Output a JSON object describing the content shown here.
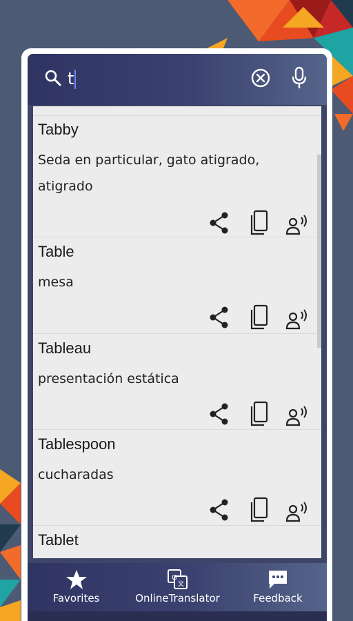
{
  "search": {
    "value": "t",
    "icon": "search-icon",
    "clear_icon": "clear-icon",
    "mic_icon": "mic-icon"
  },
  "results": [
    {
      "word": "Tabby",
      "translation": "Seda en particular, gato atigrado, atigrado"
    },
    {
      "word": "Table",
      "translation": "mesa"
    },
    {
      "word": "Tableau",
      "translation": "presentación estática"
    },
    {
      "word": "Tablespoon",
      "translation": "cucharadas"
    },
    {
      "word": "Tablet",
      "translation": ""
    }
  ],
  "row_actions": [
    "share-icon",
    "copy-icon",
    "speak-icon"
  ],
  "nav": {
    "favorites": "Favorites",
    "online": "OnlineTranslator",
    "feedback": "Feedback"
  },
  "colors": {
    "background": "#4c5a73",
    "header": "#3c4270",
    "list_background": "#ececec",
    "accent_caret": "#6e86ff"
  }
}
